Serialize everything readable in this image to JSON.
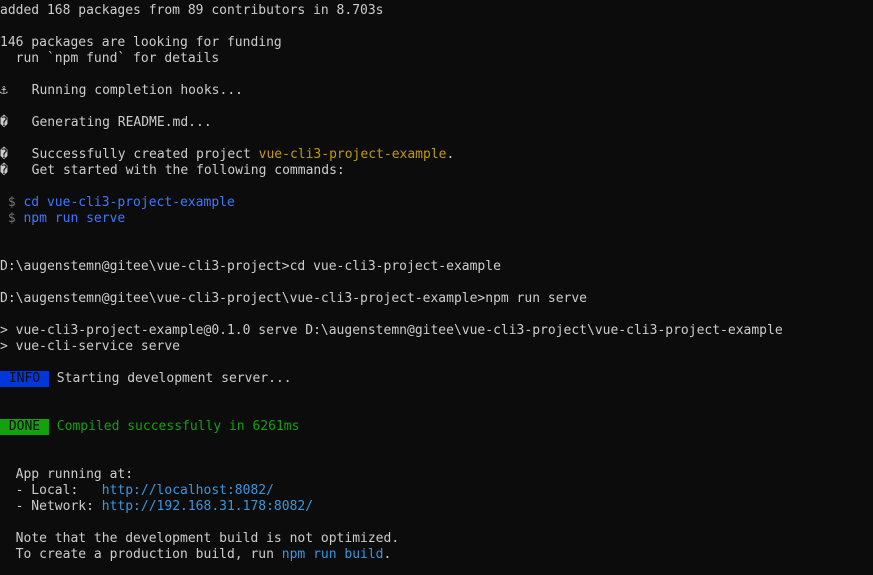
{
  "install": {
    "added": "added 168 packages from 89 contributors in 8.703s",
    "funding": "146 packages are looking for funding",
    "fund_hint": "  run `npm fund` for details"
  },
  "hooks": {
    "anchor_icon": "⚓",
    "running": "  Running completion hooks...",
    "unknown_icon": "�",
    "readme": "  Generating README.md...",
    "success_prefix": "  Successfully created project ",
    "project_name": "vue-cli3-project-example",
    "success_suffix": ".",
    "get_started": "  Get started with the following commands:"
  },
  "commands": {
    "prompt": " $ ",
    "cd": "cd vue-cli3-project-example",
    "serve": "npm run serve"
  },
  "shell": {
    "line1": "D:\\augenstemn@gitee\\vue-cli3-project>cd vue-cli3-project-example",
    "line2": "D:\\augenstemn@gitee\\vue-cli3-project\\vue-cli3-project-example>npm run serve"
  },
  "npm": {
    "line1": "> vue-cli3-project-example@0.1.0 serve D:\\augenstemn@gitee\\vue-cli3-project\\vue-cli3-project-example",
    "line2": "> vue-cli-service serve"
  },
  "status": {
    "info_badge": " INFO ",
    "info_text": " Starting development server...",
    "done_badge": " DONE ",
    "done_text": " Compiled successfully in 6261ms"
  },
  "app": {
    "running_at": "  App running at:",
    "local_label": "  - Local:   ",
    "local_url": "http://localhost:8082/",
    "network_label": "  - Network: ",
    "network_url": "http://192.168.31.178:8082/"
  },
  "note": {
    "line1": "  Note that the development build is not optimized.",
    "line2_prefix": "  To create a production build, run ",
    "build_cmd": "npm run build",
    "line2_suffix": "."
  },
  "colors": {
    "background": "#0c0c0c",
    "foreground": "#cccccc",
    "project_name": "#c19c00",
    "command": "#3b78ff",
    "url": "#3a96dd",
    "info_badge": "#0037da",
    "done": "#13a10e"
  }
}
